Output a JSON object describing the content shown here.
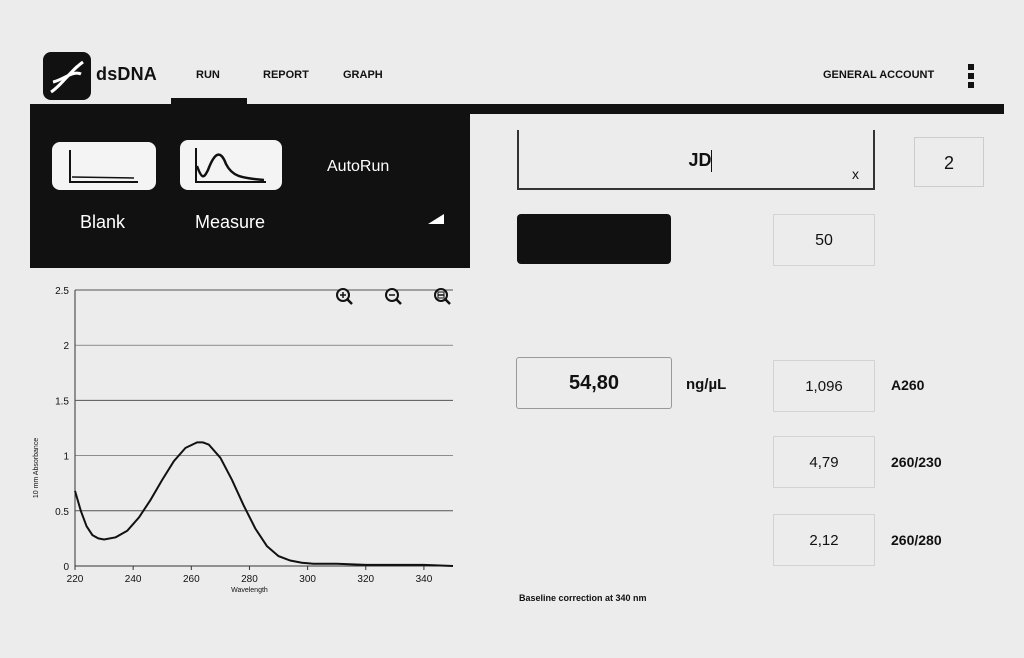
{
  "header": {
    "app_title": "dsDNA",
    "nav": [
      {
        "label": "RUN",
        "active": true
      },
      {
        "label": "REPORT",
        "active": false
      },
      {
        "label": "GRAPH",
        "active": false
      }
    ],
    "account": "GENERAL ACCOUNT",
    "menu_icon": "kebab-menu-icon",
    "logo_icon": "dna-helix-icon"
  },
  "run_panel": {
    "blank_label": "Blank",
    "measure_label": "Measure",
    "autorun_label": "AutoRun",
    "blank_icon": "baseline-graph-icon",
    "measure_icon": "peak-graph-icon"
  },
  "sample": {
    "name": "JD",
    "clear_label": "x",
    "count": "2"
  },
  "results": {
    "dilution": "50",
    "concentration": "54,80",
    "unit": "ng/µL",
    "rows": [
      {
        "value": "1,096",
        "label": "A260"
      },
      {
        "value": "4,79",
        "label": "260/230"
      },
      {
        "value": "2,12",
        "label": "260/280"
      }
    ],
    "baseline_note": "Baseline correction at 340 nm"
  },
  "zoom_icons": [
    "zoom-in-icon",
    "zoom-out-icon",
    "zoom-reset-icon"
  ],
  "chart_data": {
    "type": "line",
    "xlabel": "Wavelength",
    "ylabel": "10 mm Absorbance",
    "xlim": [
      220,
      350
    ],
    "ylim": [
      0,
      2.5
    ],
    "x_ticks": [
      "220",
      "240",
      "260",
      "280",
      "300",
      "320",
      "340"
    ],
    "y_ticks": [
      "0",
      "0.5",
      "1",
      "1.5",
      "2",
      "2.5"
    ],
    "grid": true,
    "x": [
      220,
      222,
      224,
      226,
      228,
      230,
      234,
      238,
      242,
      246,
      250,
      254,
      258,
      262,
      264,
      266,
      270,
      274,
      278,
      282,
      286,
      290,
      294,
      298,
      302,
      310,
      320,
      330,
      340,
      350
    ],
    "y": [
      0.68,
      0.5,
      0.36,
      0.28,
      0.25,
      0.24,
      0.26,
      0.32,
      0.44,
      0.6,
      0.78,
      0.95,
      1.07,
      1.12,
      1.12,
      1.1,
      0.98,
      0.78,
      0.55,
      0.34,
      0.18,
      0.09,
      0.05,
      0.03,
      0.02,
      0.02,
      0.01,
      0.01,
      0.01,
      0.0
    ]
  }
}
